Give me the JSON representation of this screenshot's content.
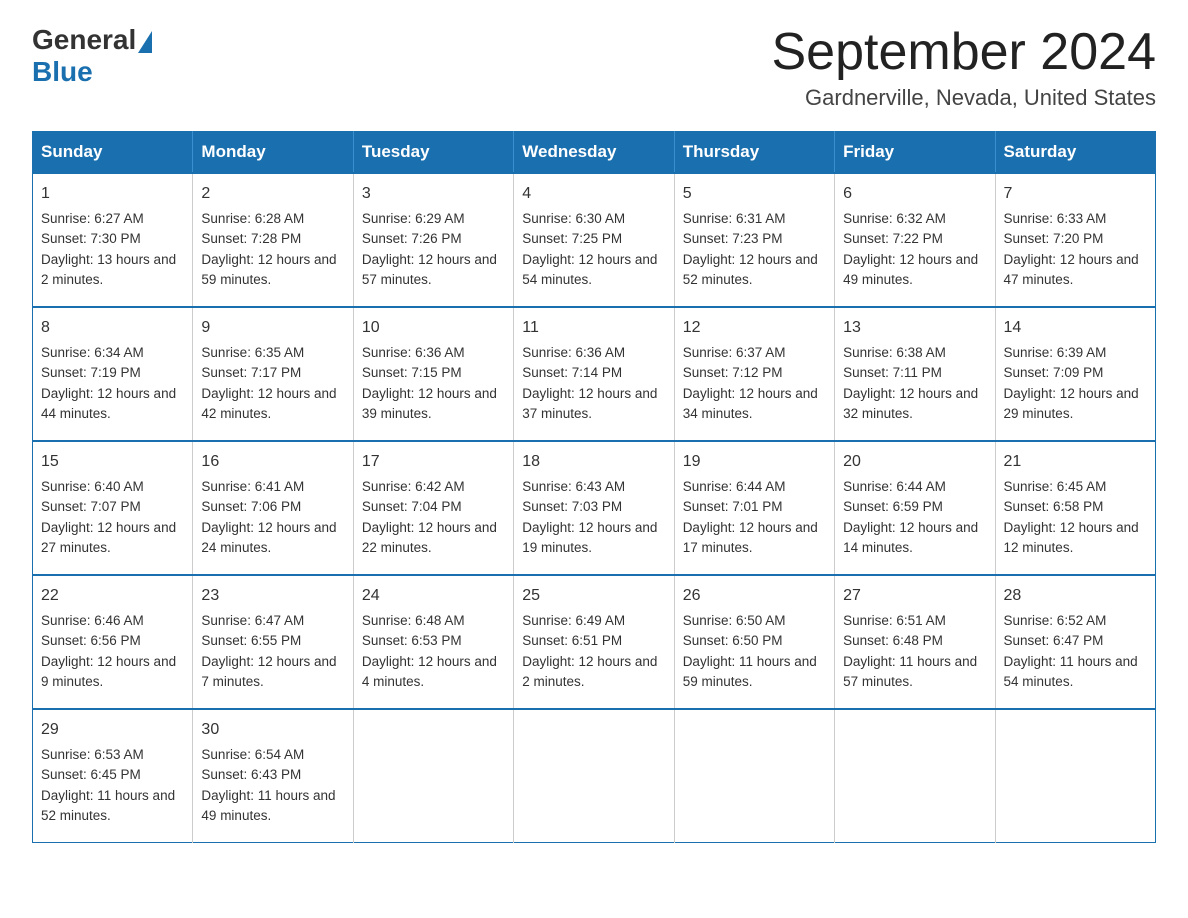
{
  "logo": {
    "general": "General",
    "blue": "Blue"
  },
  "title": "September 2024",
  "subtitle": "Gardnerville, Nevada, United States",
  "days_of_week": [
    "Sunday",
    "Monday",
    "Tuesday",
    "Wednesday",
    "Thursday",
    "Friday",
    "Saturday"
  ],
  "weeks": [
    [
      {
        "day": "1",
        "sunrise": "Sunrise: 6:27 AM",
        "sunset": "Sunset: 7:30 PM",
        "daylight": "Daylight: 13 hours and 2 minutes."
      },
      {
        "day": "2",
        "sunrise": "Sunrise: 6:28 AM",
        "sunset": "Sunset: 7:28 PM",
        "daylight": "Daylight: 12 hours and 59 minutes."
      },
      {
        "day": "3",
        "sunrise": "Sunrise: 6:29 AM",
        "sunset": "Sunset: 7:26 PM",
        "daylight": "Daylight: 12 hours and 57 minutes."
      },
      {
        "day": "4",
        "sunrise": "Sunrise: 6:30 AM",
        "sunset": "Sunset: 7:25 PM",
        "daylight": "Daylight: 12 hours and 54 minutes."
      },
      {
        "day": "5",
        "sunrise": "Sunrise: 6:31 AM",
        "sunset": "Sunset: 7:23 PM",
        "daylight": "Daylight: 12 hours and 52 minutes."
      },
      {
        "day": "6",
        "sunrise": "Sunrise: 6:32 AM",
        "sunset": "Sunset: 7:22 PM",
        "daylight": "Daylight: 12 hours and 49 minutes."
      },
      {
        "day": "7",
        "sunrise": "Sunrise: 6:33 AM",
        "sunset": "Sunset: 7:20 PM",
        "daylight": "Daylight: 12 hours and 47 minutes."
      }
    ],
    [
      {
        "day": "8",
        "sunrise": "Sunrise: 6:34 AM",
        "sunset": "Sunset: 7:19 PM",
        "daylight": "Daylight: 12 hours and 44 minutes."
      },
      {
        "day": "9",
        "sunrise": "Sunrise: 6:35 AM",
        "sunset": "Sunset: 7:17 PM",
        "daylight": "Daylight: 12 hours and 42 minutes."
      },
      {
        "day": "10",
        "sunrise": "Sunrise: 6:36 AM",
        "sunset": "Sunset: 7:15 PM",
        "daylight": "Daylight: 12 hours and 39 minutes."
      },
      {
        "day": "11",
        "sunrise": "Sunrise: 6:36 AM",
        "sunset": "Sunset: 7:14 PM",
        "daylight": "Daylight: 12 hours and 37 minutes."
      },
      {
        "day": "12",
        "sunrise": "Sunrise: 6:37 AM",
        "sunset": "Sunset: 7:12 PM",
        "daylight": "Daylight: 12 hours and 34 minutes."
      },
      {
        "day": "13",
        "sunrise": "Sunrise: 6:38 AM",
        "sunset": "Sunset: 7:11 PM",
        "daylight": "Daylight: 12 hours and 32 minutes."
      },
      {
        "day": "14",
        "sunrise": "Sunrise: 6:39 AM",
        "sunset": "Sunset: 7:09 PM",
        "daylight": "Daylight: 12 hours and 29 minutes."
      }
    ],
    [
      {
        "day": "15",
        "sunrise": "Sunrise: 6:40 AM",
        "sunset": "Sunset: 7:07 PM",
        "daylight": "Daylight: 12 hours and 27 minutes."
      },
      {
        "day": "16",
        "sunrise": "Sunrise: 6:41 AM",
        "sunset": "Sunset: 7:06 PM",
        "daylight": "Daylight: 12 hours and 24 minutes."
      },
      {
        "day": "17",
        "sunrise": "Sunrise: 6:42 AM",
        "sunset": "Sunset: 7:04 PM",
        "daylight": "Daylight: 12 hours and 22 minutes."
      },
      {
        "day": "18",
        "sunrise": "Sunrise: 6:43 AM",
        "sunset": "Sunset: 7:03 PM",
        "daylight": "Daylight: 12 hours and 19 minutes."
      },
      {
        "day": "19",
        "sunrise": "Sunrise: 6:44 AM",
        "sunset": "Sunset: 7:01 PM",
        "daylight": "Daylight: 12 hours and 17 minutes."
      },
      {
        "day": "20",
        "sunrise": "Sunrise: 6:44 AM",
        "sunset": "Sunset: 6:59 PM",
        "daylight": "Daylight: 12 hours and 14 minutes."
      },
      {
        "day": "21",
        "sunrise": "Sunrise: 6:45 AM",
        "sunset": "Sunset: 6:58 PM",
        "daylight": "Daylight: 12 hours and 12 minutes."
      }
    ],
    [
      {
        "day": "22",
        "sunrise": "Sunrise: 6:46 AM",
        "sunset": "Sunset: 6:56 PM",
        "daylight": "Daylight: 12 hours and 9 minutes."
      },
      {
        "day": "23",
        "sunrise": "Sunrise: 6:47 AM",
        "sunset": "Sunset: 6:55 PM",
        "daylight": "Daylight: 12 hours and 7 minutes."
      },
      {
        "day": "24",
        "sunrise": "Sunrise: 6:48 AM",
        "sunset": "Sunset: 6:53 PM",
        "daylight": "Daylight: 12 hours and 4 minutes."
      },
      {
        "day": "25",
        "sunrise": "Sunrise: 6:49 AM",
        "sunset": "Sunset: 6:51 PM",
        "daylight": "Daylight: 12 hours and 2 minutes."
      },
      {
        "day": "26",
        "sunrise": "Sunrise: 6:50 AM",
        "sunset": "Sunset: 6:50 PM",
        "daylight": "Daylight: 11 hours and 59 minutes."
      },
      {
        "day": "27",
        "sunrise": "Sunrise: 6:51 AM",
        "sunset": "Sunset: 6:48 PM",
        "daylight": "Daylight: 11 hours and 57 minutes."
      },
      {
        "day": "28",
        "sunrise": "Sunrise: 6:52 AM",
        "sunset": "Sunset: 6:47 PM",
        "daylight": "Daylight: 11 hours and 54 minutes."
      }
    ],
    [
      {
        "day": "29",
        "sunrise": "Sunrise: 6:53 AM",
        "sunset": "Sunset: 6:45 PM",
        "daylight": "Daylight: 11 hours and 52 minutes."
      },
      {
        "day": "30",
        "sunrise": "Sunrise: 6:54 AM",
        "sunset": "Sunset: 6:43 PM",
        "daylight": "Daylight: 11 hours and 49 minutes."
      },
      null,
      null,
      null,
      null,
      null
    ]
  ]
}
